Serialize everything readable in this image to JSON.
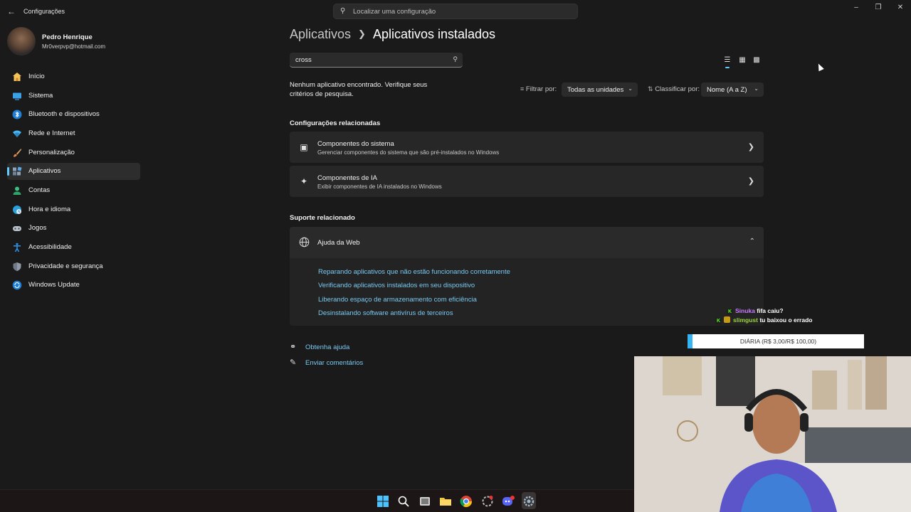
{
  "window": {
    "title": "Configurações",
    "search_placeholder": "Localizar uma configuração"
  },
  "user": {
    "name": "Pedro Henrique",
    "email": "Mr0verpvp@hotmail.com"
  },
  "sidebar": {
    "items": [
      {
        "label": "Início",
        "icon": "home-icon"
      },
      {
        "label": "Sistema",
        "icon": "system-icon"
      },
      {
        "label": "Bluetooth e dispositivos",
        "icon": "bluetooth-icon"
      },
      {
        "label": "Rede e Internet",
        "icon": "network-icon"
      },
      {
        "label": "Personalização",
        "icon": "brush-icon"
      },
      {
        "label": "Aplicativos",
        "icon": "apps-icon"
      },
      {
        "label": "Contas",
        "icon": "accounts-icon"
      },
      {
        "label": "Hora e idioma",
        "icon": "time-language-icon"
      },
      {
        "label": "Jogos",
        "icon": "gaming-icon"
      },
      {
        "label": "Acessibilidade",
        "icon": "accessibility-icon"
      },
      {
        "label": "Privacidade e segurança",
        "icon": "shield-icon"
      },
      {
        "label": "Windows Update",
        "icon": "update-icon"
      }
    ],
    "active": "Aplicativos"
  },
  "main": {
    "breadcrumb_parent": "Aplicativos",
    "breadcrumb_current": "Aplicativos instalados",
    "search_value": "cross",
    "no_result_text": "Nenhum aplicativo encontrado. Verifique seus critérios de pesquisa.",
    "filter_label": "Filtrar por:",
    "filter_value": "Todas as unidades",
    "sort_label": "Classificar por:",
    "sort_value": "Nome (A a Z)",
    "related_settings_heading": "Configurações relacionadas",
    "cards": [
      {
        "title": "Componentes do sistema",
        "subtitle": "Gerenciar componentes do sistema que são pré-instalados no Windows"
      },
      {
        "title": "Componentes de IA",
        "subtitle": "Exibir componentes de IA instalados no Windows"
      }
    ],
    "related_support_heading": "Suporte relacionado",
    "web_help": {
      "title": "Ajuda da Web",
      "links": [
        "Reparando aplicativos que não estão funcionando corretamente",
        "Verificando aplicativos instalados em seu dispositivo",
        "Liberando espaço de armazenamento com eficiência",
        "Desinstalando software antivírus de terceiros"
      ]
    },
    "get_help": "Obtenha ajuda",
    "send_feedback": "Enviar comentários"
  },
  "overlay": {
    "chat": [
      {
        "user": "Sinuka",
        "message": "fifa caiu?",
        "color": "#c77dff"
      },
      {
        "user": "slimgust",
        "message": "tu baixou o errado",
        "color": "#9bd43a"
      }
    ],
    "goal": "DIÁRIA (R$ 3,00/R$ 100,00)",
    "goal_color": "#36b3f0"
  },
  "colors": {
    "accent": "#60cdff",
    "link": "#79c9f2"
  }
}
